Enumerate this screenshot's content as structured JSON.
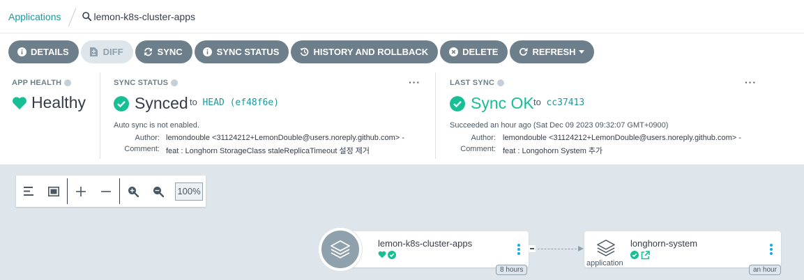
{
  "breadcrumb": {
    "root": "Applications",
    "current": "lemon-k8s-cluster-apps"
  },
  "toolbar": {
    "details": "DETAILS",
    "diff": "DIFF",
    "sync": "SYNC",
    "sync_status": "SYNC STATUS",
    "history": "HISTORY AND ROLLBACK",
    "delete": "DELETE",
    "refresh": "REFRESH"
  },
  "app_health": {
    "label": "APP HEALTH",
    "value": "Healthy"
  },
  "sync_status": {
    "label": "SYNC STATUS",
    "value": "Synced",
    "to": "to",
    "revision": "HEAD (ef48f6e)",
    "note": "Auto sync is not enabled.",
    "author_label": "Author:",
    "author": "lemondouble <31124212+LemonDouble@users.noreply.github.com> -",
    "comment_label": "Comment:",
    "comment": "feat : Longhorn StorageClass staleReplicaTimeout 설정 제거"
  },
  "last_sync": {
    "label": "LAST SYNC",
    "value": "Sync OK",
    "to": "to",
    "revision": "cc37413",
    "note": "Succeeded an hour ago (Sat Dec 09 2023 09:32:07 GMT+0900)",
    "author_label": "Author:",
    "author": "lemondouble <31124212+LemonDouble@users.noreply.github.com> -",
    "comment_label": "Comment:",
    "comment": "feat : Longohorn System 추가"
  },
  "graph": {
    "zoom": "100%",
    "nodes": [
      {
        "name": "lemon-k8s-cluster-apps",
        "age": "8 hours"
      },
      {
        "name": "longhorn-system",
        "kind": "application",
        "age": "an hour"
      }
    ]
  },
  "colors": {
    "accent": "#1a9a9a",
    "healthy": "#18be94",
    "button": "#6d7f8b",
    "canvas": "#dee6eb"
  }
}
